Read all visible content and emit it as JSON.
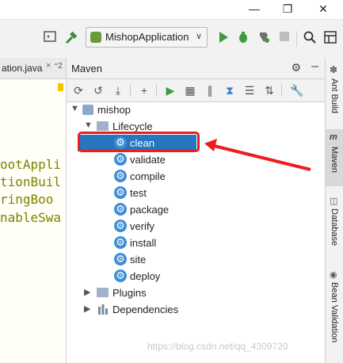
{
  "window": {
    "minimize": "—",
    "restore": "❐",
    "close": "✕"
  },
  "toolbar": {
    "run_config": "MishopApplication",
    "icons": [
      "layout-icon",
      "build-hammer-icon",
      "run-icon",
      "debug-icon",
      "coverage-icon",
      "stop-icon",
      "search-icon",
      "project-structure-icon"
    ]
  },
  "editor": {
    "tab_label": "ation.java",
    "tab_close": "×",
    "tab_more": "⁼2",
    "lines": [
      "ootAppli",
      "tionBuil",
      "ringBoo",
      "nableSwa"
    ]
  },
  "maven": {
    "title": "Maven",
    "root": "mishop",
    "lifecycle_label": "Lifecycle",
    "goals": [
      "clean",
      "validate",
      "compile",
      "test",
      "package",
      "verify",
      "install",
      "site",
      "deploy"
    ],
    "selected_goal": "clean",
    "plugins_label": "Plugins",
    "dependencies_label": "Dependencies"
  },
  "sidebar": {
    "tabs": [
      "Ant Build",
      "Maven",
      "Database",
      "Bean Validation"
    ],
    "active": "Maven"
  },
  "watermark": "https://blog.csdn.net/qq_4309720",
  "colors": {
    "selection": "#2675bf",
    "annotation": "#ee1c1c",
    "gear": "#3a8fd6"
  }
}
